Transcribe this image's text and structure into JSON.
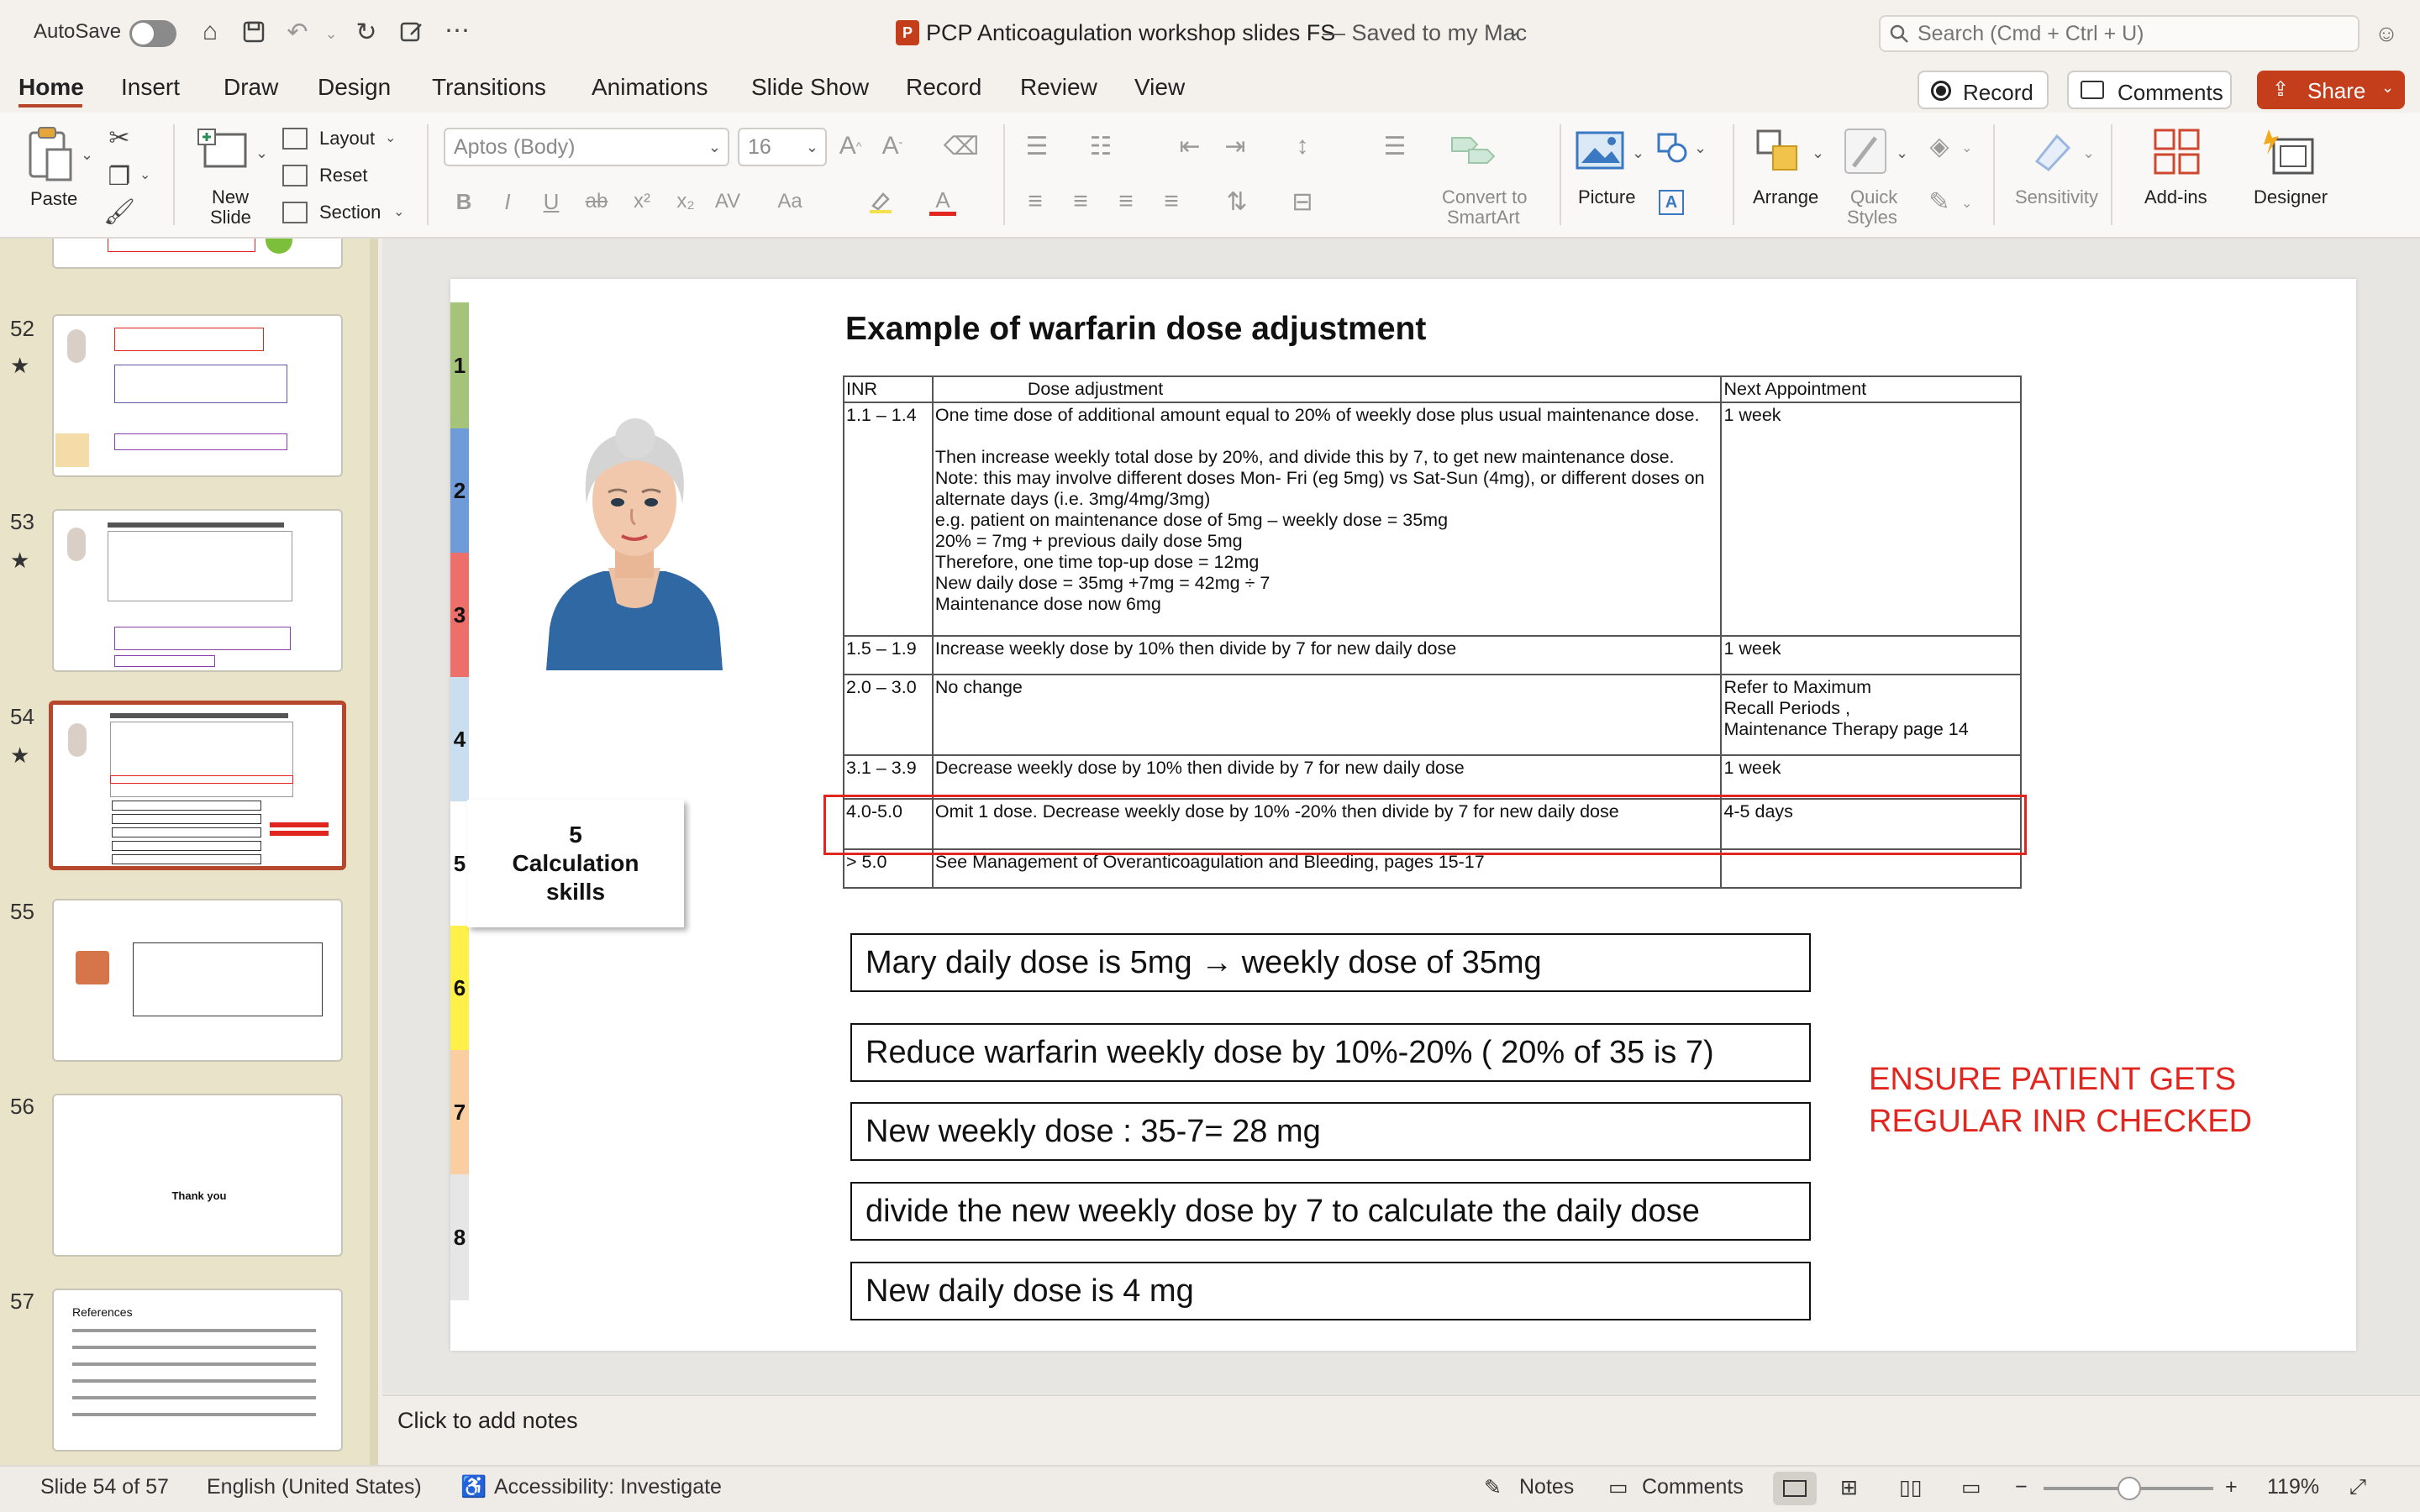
{
  "window": {
    "autosave_label": "AutoSave",
    "doc_title": "PCP Anticoagulation workshop slides FS",
    "save_status": "— Saved to my Mac",
    "search_placeholder": "Search (Cmd + Ctrl + U)"
  },
  "tabs": [
    "Home",
    "Insert",
    "Draw",
    "Design",
    "Transitions",
    "Animations",
    "Slide Show",
    "Record",
    "Review",
    "View"
  ],
  "tab_actions": {
    "record": "Record",
    "comments": "Comments",
    "share": "Share"
  },
  "ribbon": {
    "paste": "Paste",
    "new_slide_1": "New",
    "new_slide_2": "Slide",
    "layout": "Layout",
    "reset": "Reset",
    "section": "Section",
    "font_name": "Aptos (Body)",
    "font_size": "16",
    "convert_1": "Convert to",
    "convert_2": "SmartArt",
    "picture": "Picture",
    "arrange": "Arrange",
    "quick_1": "Quick",
    "quick_2": "Styles",
    "sensitivity": "Sensitivity",
    "addins": "Add-ins",
    "designer": "Designer"
  },
  "thumbnails": [
    {
      "num": "52",
      "star": true
    },
    {
      "num": "53",
      "star": true
    },
    {
      "num": "54",
      "star": true,
      "selected": true
    },
    {
      "num": "55",
      "star": false
    },
    {
      "num": "56",
      "star": false,
      "text": "Thank you"
    },
    {
      "num": "57",
      "star": false,
      "text": "References"
    }
  ],
  "slide": {
    "title": "Example of warfarin dose adjustment",
    "bands": [
      "1",
      "2",
      "3",
      "4",
      "5",
      "6",
      "7",
      "8"
    ],
    "skills_label_num": "5",
    "skills_label_1": "Calculation",
    "skills_label_2": "skills",
    "table": {
      "headers": [
        "INR",
        "Dose adjustment",
        "Next Appointment"
      ],
      "rows": [
        {
          "inr": "1.1 – 1.4",
          "dose": "One time dose of additional amount equal to 20% of weekly dose plus usual maintenance dose.\n\nThen increase weekly total dose by 20%, and divide this by 7, to get new maintenance dose.\nNote: this may involve different doses Mon- Fri (eg 5mg) vs Sat-Sun (4mg), or different doses on alternate days (i.e. 3mg/4mg/3mg)\ne.g. patient on maintenance dose of 5mg – weekly dose = 35mg\n20% = 7mg + previous daily dose 5mg\nTherefore, one time top-up dose = 12mg\nNew daily dose = 35mg +7mg = 42mg ÷ 7\nMaintenance dose now 6mg",
          "next": "1 week"
        },
        {
          "inr": "1.5 – 1.9",
          "dose": "Increase weekly dose by 10% then divide by 7 for new daily dose",
          "next": "1 week"
        },
        {
          "inr": "2.0 – 3.0",
          "dose": "No change",
          "next": "Refer to Maximum\nRecall Periods ,\nMaintenance Therapy page 14"
        },
        {
          "inr": "3.1 – 3.9",
          "dose": "Decrease weekly dose by 10% then divide by 7 for new daily dose",
          "next": "1 week"
        },
        {
          "inr": "4.0-5.0",
          "dose": "Omit 1 dose. Decrease weekly dose by 10% -20% then divide by 7 for new daily dose",
          "next": "4-5 days"
        },
        {
          "inr": "> 5.0",
          "dose": "See Management of Overanticoagulation and Bleeding, pages 15-17",
          "next": ""
        }
      ]
    },
    "calc_steps": [
      "Mary daily dose is 5mg → weekly dose of 35mg",
      "Reduce warfarin weekly dose by 10%-20% ( 20% of 35 is 7)",
      "New weekly dose : 35-7= 28 mg",
      "divide the new weekly dose by 7 to calculate the daily dose",
      "New daily dose is 4 mg"
    ],
    "warning_1": "ENSURE PATIENT GETS",
    "warning_2": "REGULAR INR CHECKED"
  },
  "notes_placeholder": "Click to add notes",
  "status": {
    "slide_info": "Slide 54 of 57",
    "language": "English (United States)",
    "accessibility": "Accessibility: Investigate",
    "notes": "Notes",
    "comments": "Comments",
    "zoom": "119%"
  },
  "colors": {
    "accent": "#b7472a",
    "highlight_box": "#e0261f",
    "warning_text": "#e0261f",
    "band_colors": [
      "#a6c37a",
      "#6f9bd9",
      "#ec6f6a",
      "#c9dff0",
      "#ffffff",
      "#fff14a",
      "#f9cfa2",
      "#e6e6e6"
    ]
  }
}
